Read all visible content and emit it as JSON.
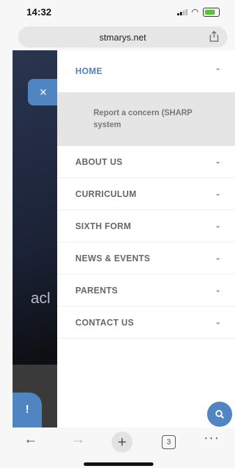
{
  "status": {
    "time": "14:32"
  },
  "browser": {
    "url": "stmarys.net",
    "tab_count": "3"
  },
  "hero": {
    "partial_text": "acl"
  },
  "menu": {
    "close_symbol": "×",
    "items": [
      {
        "label": "HOME"
      },
      {
        "label": "ABOUT US"
      },
      {
        "label": "CURRICULUM"
      },
      {
        "label": "SIXTH FORM"
      },
      {
        "label": "NEWS & EVENTS"
      },
      {
        "label": "PARENTS"
      },
      {
        "label": "CONTACT US"
      }
    ],
    "home_submenu": [
      "Report a concern (SHARP system"
    ]
  },
  "icons": {
    "close": "close-icon",
    "chevron_up": "chevron-up-icon",
    "chevron_down": "chevron-down-icon",
    "search": "search-icon",
    "alert": "exclamation-icon",
    "share": "share-icon"
  },
  "colors": {
    "accent": "#4f86c1"
  },
  "alert_symbol": "!"
}
